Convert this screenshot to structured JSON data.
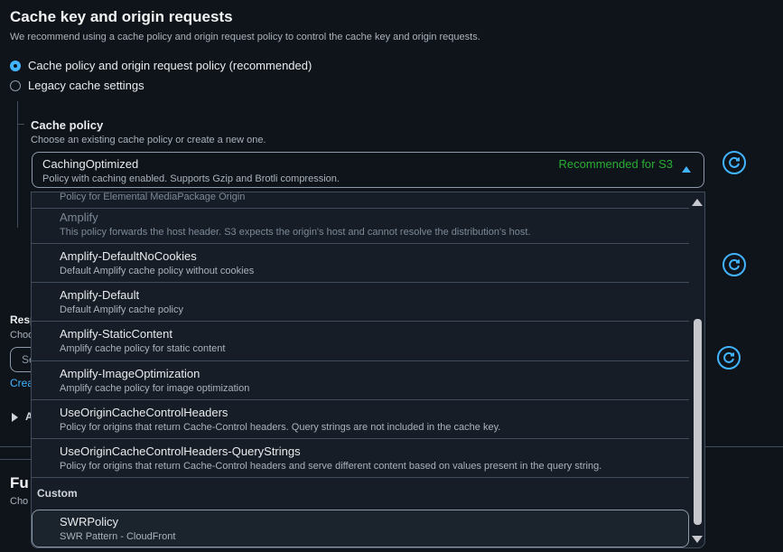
{
  "section": {
    "title": "Cache key and origin requests",
    "description": "We recommend using a cache policy and origin request policy to control the cache key and origin requests."
  },
  "options": {
    "recommended": "Cache policy and origin request policy (recommended)",
    "legacy": "Legacy cache settings"
  },
  "cache_policy": {
    "label": "Cache policy",
    "description": "Choose an existing cache policy or create a new one.",
    "selected_value": "CachingOptimized",
    "selected_description": "Policy with caching enabled. Supports Gzip and Brotli compression.",
    "recommended_badge": "Recommended for S3"
  },
  "background": {
    "resp_label": "Resp",
    "choose_label": "Choo",
    "input_placeholder": "Se",
    "create_link": "Crea",
    "expand_label": "A",
    "fun_label": "Fu",
    "fun_desc": "Cho"
  },
  "dropdown": {
    "partial_top": "Policy for Elemental MediaPackage Origin",
    "items": [
      {
        "label": "Amplify",
        "desc": "This policy forwards the host header. S3 expects the origin's host and cannot resolve the distribution's host."
      },
      {
        "label": "Amplify-DefaultNoCookies",
        "desc": "Default Amplify cache policy without cookies"
      },
      {
        "label": "Amplify-Default",
        "desc": "Default Amplify cache policy"
      },
      {
        "label": "Amplify-StaticContent",
        "desc": "Amplify cache policy for static content"
      },
      {
        "label": "Amplify-ImageOptimization",
        "desc": "Amplify cache policy for image optimization"
      },
      {
        "label": "UseOriginCacheControlHeaders",
        "desc": "Policy for origins that return Cache-Control headers. Query strings are not included in the cache key."
      },
      {
        "label": "UseOriginCacheControlHeaders-QueryStrings",
        "desc": "Policy for origins that return Cache-Control headers and serve different content based on values present in the query string."
      }
    ],
    "custom_group": "Custom",
    "custom_items": [
      {
        "label": "SWRPolicy",
        "desc": "SWR Pattern - CloudFront"
      }
    ]
  },
  "colors": {
    "accent": "#42b4ff",
    "success": "#29ad32",
    "background": "#0f141b"
  }
}
